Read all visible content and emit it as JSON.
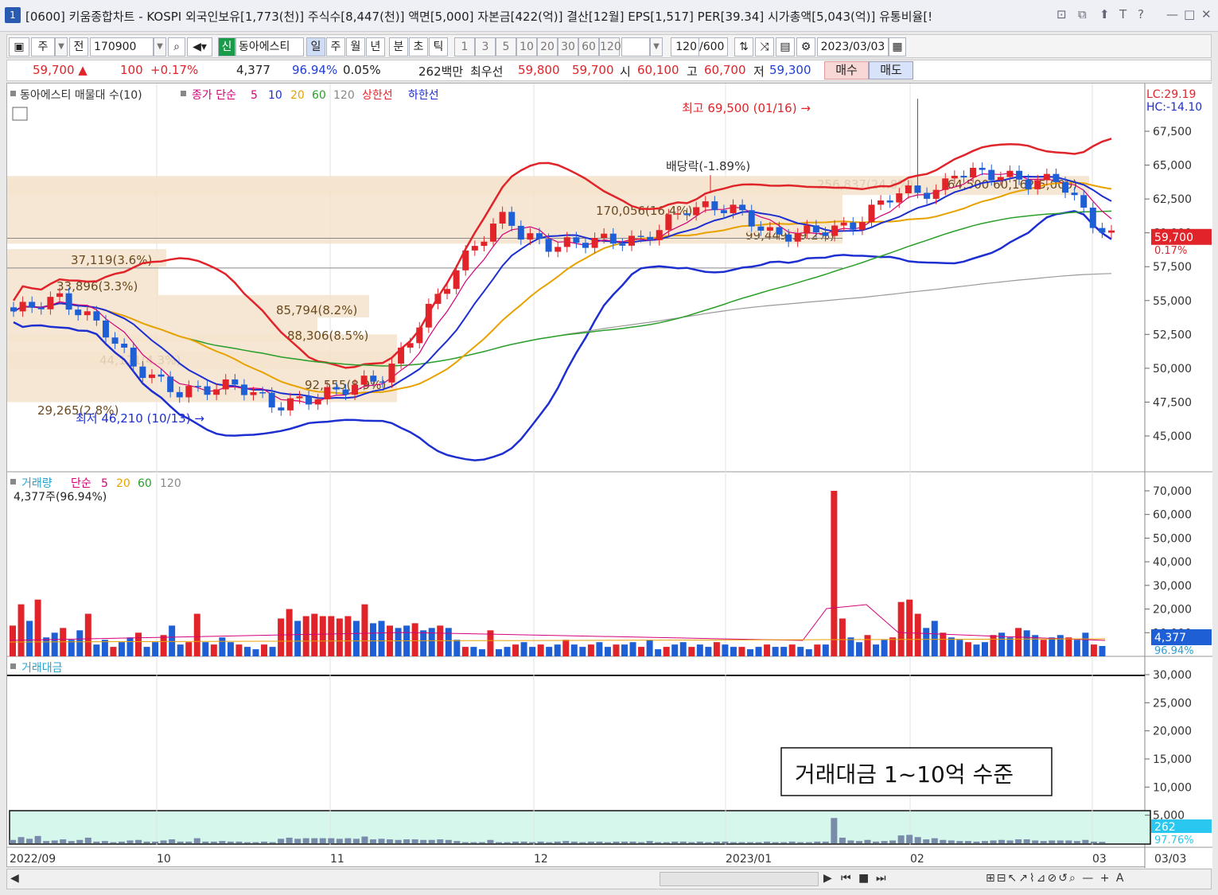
{
  "window": {
    "window_id": "1",
    "title": "[0600] 키움종합차트 - KOSPI 외국인보유[1,773(천)] 주식수[8,447(천)] 액면[5,000] 자본금[422(억)] 결산[12월] EPS[1,517] PER[39.34] 시가총액[5,043(억)] 유통비율[!",
    "controls": [
      "⊡",
      "⧉",
      "⬆",
      "T",
      "?",
      "—",
      "□",
      "✕"
    ]
  },
  "toolbar": {
    "type_label": "주",
    "prev_label": "전",
    "code_value": "170900",
    "new_badge": "신",
    "stock_name": "동아에스티",
    "periods": [
      "일",
      "주",
      "월",
      "년",
      "분",
      "초",
      "틱"
    ],
    "intervals": [
      "1",
      "3",
      "5",
      "10",
      "20",
      "30",
      "60",
      "120"
    ],
    "count_value": "120",
    "count_total": "/600",
    "date_value": "2023/03/03"
  },
  "quote": {
    "price": "59,700 ▲",
    "change": "100",
    "change_pct": "+0.17%",
    "volume": "4,377",
    "vol_ratio": "96.94%",
    "turnover_rate": "0.05%",
    "amount": "262백만",
    "bid_label": "최우선",
    "bid1": "59,800",
    "bid2": "59,700",
    "open_label": "시",
    "open": "60,100",
    "high_label": "고",
    "high": "60,700",
    "low_label": "저",
    "low": "59,300",
    "buy_label": "매수",
    "sell_label": "매도"
  },
  "chart_data": [
    {
      "type": "line",
      "legend": [
        "동아에스티 매물대 수(10)",
        "종가 단순",
        "5",
        "10",
        "20",
        "60",
        "120",
        "상한선",
        "하한선"
      ],
      "lc_hc": [
        "LC:29.19",
        "HC:-14.10"
      ],
      "price_axis": [
        "67,500",
        "65,000",
        "62,500",
        "60,000",
        "57,500",
        "55,000",
        "52,500",
        "50,000",
        "47,500",
        "45,000"
      ],
      "last_price_label": "59,700",
      "last_change_label": "0.17%",
      "annotations": {
        "high": "최고 69,500 (01/16)",
        "low": "최저 46,210 (10/13)",
        "dividend": "배당락(-1.89%)"
      },
      "volume_profile": [
        {
          "label": "29,265(2.8%)"
        },
        {
          "label": "44,171(4.3%)"
        },
        {
          "label": "92,555(8.9%)"
        },
        {
          "label": "88,306(8.5%)"
        },
        {
          "label": "85,794(8.2%)"
        },
        {
          "label": "33,896(3.3%)"
        },
        {
          "label": "37,119(3.6%)"
        },
        {
          "label": "99,449(19.2%)"
        },
        {
          "label": "170,056(16.4%)"
        },
        {
          "label": "256,837(24.8%)"
        },
        {
          "label": "(64,500 60,162.5,000)"
        }
      ]
    },
    {
      "type": "bar",
      "legend": [
        "거래량",
        "단순",
        "5",
        "20",
        "60",
        "120"
      ],
      "info": "4,377주(96.94%)",
      "axis": [
        "70,000",
        "60,000",
        "50,000",
        "40,000",
        "30,000",
        "20,000",
        "10,000"
      ],
      "last_label": "4,377",
      "last_pct": "96.94%",
      "values": [
        13000,
        22000,
        15000,
        24000,
        8000,
        10000,
        12000,
        7000,
        11000,
        18000,
        5000,
        7000,
        4000,
        6000,
        8000,
        10000,
        4000,
        6000,
        9000,
        13000,
        5000,
        6000,
        18000,
        6000,
        5000,
        8000,
        6000,
        5000,
        4000,
        3000,
        5000,
        4000,
        16000,
        20000,
        15000,
        17000,
        18000,
        17000,
        17000,
        16000,
        17000,
        15000,
        22000,
        14000,
        15000,
        13000,
        12000,
        13000,
        14000,
        11000,
        12000,
        13000,
        12000,
        7000,
        4000,
        4000,
        3000,
        11000,
        3000,
        4000,
        5000,
        6000,
        4000,
        5000,
        4000,
        5000,
        7000,
        5000,
        4000,
        5000,
        6000,
        4000,
        5000,
        5000,
        6000,
        4000,
        7000,
        3000,
        4000,
        5000,
        6000,
        4000,
        5000,
        4000,
        6000,
        5000,
        4000,
        4000,
        3000,
        4000,
        5000,
        4000,
        4000,
        5000,
        4000,
        3000,
        5000,
        5000,
        70000,
        16000,
        8000,
        6000,
        9000,
        5000,
        7000,
        8000,
        23000,
        24000,
        18000,
        12000,
        15000,
        10000,
        8000,
        7000,
        6000,
        5000,
        6000,
        9000,
        10000,
        8000,
        12000,
        11000,
        9000,
        7000,
        8000,
        9000,
        8000,
        7000,
        10000,
        5000,
        4377
      ]
    },
    {
      "type": "bar",
      "legend": [
        "거래대금"
      ],
      "axis": [
        "30,000",
        "25,000",
        "20,000",
        "15,000",
        "10,000",
        "5,000"
      ],
      "last_label": "262",
      "last_pct": "97.76%",
      "values": [
        600,
        1100,
        800,
        1300,
        400,
        500,
        700,
        400,
        600,
        1000,
        300,
        400,
        200,
        300,
        500,
        600,
        300,
        300,
        500,
        700,
        300,
        300,
        900,
        300,
        300,
        400,
        300,
        300,
        200,
        200,
        300,
        200,
        800,
        1000,
        800,
        900,
        900,
        900,
        900,
        800,
        900,
        800,
        1200,
        700,
        800,
        700,
        600,
        700,
        700,
        600,
        600,
        700,
        600,
        400,
        200,
        200,
        200,
        600,
        200,
        200,
        300,
        300,
        200,
        300,
        200,
        300,
        400,
        300,
        200,
        300,
        300,
        200,
        300,
        300,
        300,
        200,
        400,
        200,
        200,
        300,
        300,
        200,
        300,
        200,
        300,
        300,
        200,
        200,
        200,
        200,
        300,
        200,
        200,
        300,
        200,
        200,
        300,
        300,
        4500,
        1000,
        500,
        400,
        600,
        300,
        400,
        500,
        1400,
        1500,
        1100,
        700,
        900,
        600,
        500,
        400,
        400,
        300,
        400,
        500,
        600,
        500,
        700,
        700,
        500,
        400,
        500,
        500,
        500,
        400,
        600,
        300,
        262
      ]
    }
  ],
  "annotation_box": "거래대금 1~10억 수준",
  "x_axis_labels": [
    "2022/09",
    "10",
    "11",
    "12",
    "2023/01",
    "02",
    "03"
  ],
  "x_axis_right": "03/03",
  "scroll": {
    "left": "◀",
    "controls": [
      "▶",
      "⏮",
      "■",
      "⏭"
    ],
    "right_tools": "⊞⊟↖↗⌇⊿⊘↺⌕ — + A"
  }
}
